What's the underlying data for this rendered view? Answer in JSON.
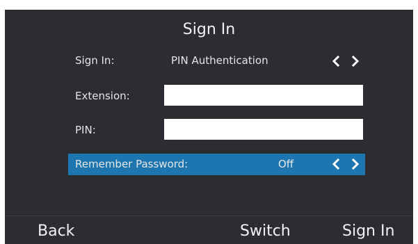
{
  "title": "Sign In",
  "rows": {
    "sign_in": {
      "label": "Sign In:",
      "value": "PIN Authentication"
    },
    "extension": {
      "label": "Extension:",
      "value": ""
    },
    "pin": {
      "label": "PIN:",
      "value": ""
    },
    "remember_password": {
      "label": "Remember Password:",
      "value": "Off"
    }
  },
  "softkeys": {
    "back": "Back",
    "switch": "Switch",
    "sign_in": "Sign In"
  },
  "colors": {
    "screen_background": "#2c2d33",
    "highlight": "#1d76b0",
    "text": "#e6e6e6",
    "input_background": "#ffffff"
  },
  "icons": {
    "left_arrow": "chevron-left-icon",
    "right_arrow": "chevron-right-icon"
  }
}
